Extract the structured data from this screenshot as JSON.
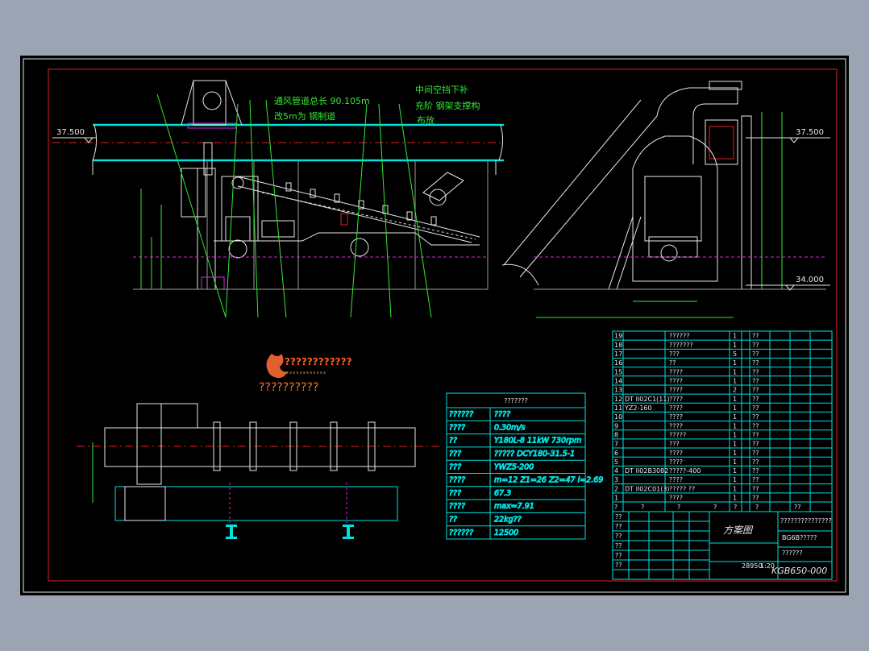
{
  "colors": {
    "background": "#9aa4b2",
    "sheet": "#000000",
    "frame": "#e02020",
    "cyan": "#00e0e0",
    "green": "#33e833",
    "white": "#e8e8e8",
    "magenta": "#e020e0",
    "red": "#ff2020"
  },
  "elevations": {
    "left": "37.500",
    "right_top": "37.500",
    "right_bottom": "34.000"
  },
  "annotations": {
    "duct_line1": "通风管道总长 90.105m",
    "duct_line2": "改5m为 钢制道",
    "mid_line1": "中间空挡下补",
    "mid_line2": "充阶 钢架支撑构",
    "mid_line3": "布放"
  },
  "watermark": {
    "line1": "????????????",
    "line2": "??????????",
    "tagline": "s s s s s s s s s s s s"
  },
  "params": {
    "title": "???????",
    "rows": [
      {
        "k": "??????",
        "v": "????"
      },
      {
        "k": "????",
        "v": "0.30m/s"
      },
      {
        "k": "??",
        "v": "Y180L-8 11kW   730rpm"
      },
      {
        "k": "???",
        "v": "????? DCY180-31.5-1"
      },
      {
        "k": "???",
        "v": "YWZ5-200"
      },
      {
        "k": "????",
        "v": "m=12 Z1=26 Z2=47 i=2.69"
      },
      {
        "k": "???",
        "v": "67.3"
      },
      {
        "k": "????",
        "v": "max=7.91"
      },
      {
        "k": "??",
        "v": "22kg??"
      },
      {
        "k": "??????",
        "v": "12500"
      }
    ]
  },
  "bom": {
    "rows": [
      {
        "no": "19",
        "code": "",
        "name": "??????",
        "qty": "1",
        "mat": "??"
      },
      {
        "no": "18",
        "code": "",
        "name": "???????",
        "qty": "1",
        "mat": "??"
      },
      {
        "no": "17",
        "code": "",
        "name": "???",
        "qty": "5",
        "mat": "??"
      },
      {
        "no": "16",
        "code": "",
        "name": "??",
        "qty": "1",
        "mat": "??"
      },
      {
        "no": "15",
        "code": "",
        "name": "????",
        "qty": "1",
        "mat": "??"
      },
      {
        "no": "14",
        "code": "",
        "name": "????",
        "qty": "1",
        "mat": "??"
      },
      {
        "no": "13",
        "code": "",
        "name": "????",
        "qty": "2",
        "mat": "??"
      },
      {
        "no": "12",
        "code": "DT II02C1(11)",
        "name": "????",
        "qty": "1",
        "mat": "??"
      },
      {
        "no": "11",
        "code": "YZ2-160",
        "name": "????",
        "qty": "1",
        "mat": "??"
      },
      {
        "no": "10",
        "code": "",
        "name": "????",
        "qty": "1",
        "mat": "??"
      },
      {
        "no": "9",
        "code": "",
        "name": "????",
        "qty": "1",
        "mat": "??"
      },
      {
        "no": "8",
        "code": "",
        "name": "?????",
        "qty": "1",
        "mat": "??"
      },
      {
        "no": "7",
        "code": "",
        "name": "???",
        "qty": "1",
        "mat": "??"
      },
      {
        "no": "6",
        "code": "",
        "name": "????",
        "qty": "1",
        "mat": "??"
      },
      {
        "no": "5",
        "code": "",
        "name": "????",
        "qty": "1",
        "mat": "??"
      },
      {
        "no": "4",
        "code": "DT II02B3082",
        "name": "?????-400",
        "qty": "1",
        "mat": "??"
      },
      {
        "no": "3",
        "code": "",
        "name": "????",
        "qty": "1",
        "mat": "??"
      },
      {
        "no": "2",
        "code": "DT II02C01(3)",
        "name": "????? ??",
        "qty": "1",
        "mat": "??"
      },
      {
        "no": "1",
        "code": "",
        "name": "????",
        "qty": "1",
        "mat": "??"
      }
    ],
    "header": [
      "?",
      "?",
      "?",
      "?",
      "?",
      "?",
      "??"
    ]
  },
  "titleblock": {
    "drawing_name": "方案图",
    "drawing_no": "KGB650-000",
    "company1": "???????????????",
    "company2": "BG6B?????",
    "company3": "??????",
    "scale": "1:20",
    "weight": "28950",
    "sign_rows": [
      "??",
      "??",
      "??",
      "??",
      "??",
      "??"
    ]
  }
}
